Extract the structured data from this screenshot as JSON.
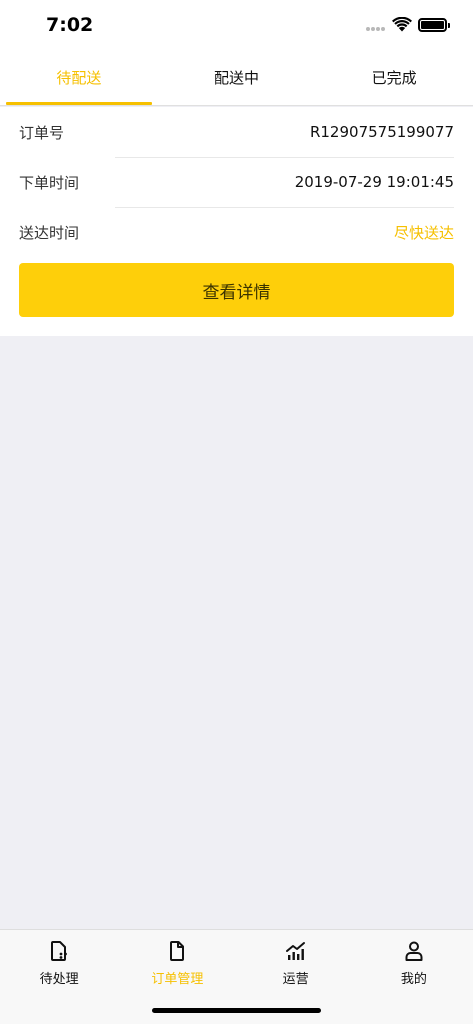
{
  "status_bar": {
    "time": "7:02"
  },
  "tabs": [
    {
      "label": "待配送",
      "active": true
    },
    {
      "label": "配送中",
      "active": false
    },
    {
      "label": "已完成",
      "active": false
    }
  ],
  "order": {
    "order_no_label": "订单号",
    "order_no_value": "R12907575199077",
    "order_time_label": "下单时间",
    "order_time_value": "2019-07-29 19:01:45",
    "delivery_time_label": "送达时间",
    "delivery_time_value": "尽快送达",
    "detail_button_label": "查看详情"
  },
  "tabbar": [
    {
      "label": "待处理",
      "icon": "pending-doc-icon",
      "active": false
    },
    {
      "label": "订单管理",
      "icon": "document-icon",
      "active": true
    },
    {
      "label": "运营",
      "icon": "chart-icon",
      "active": false
    },
    {
      "label": "我的",
      "icon": "person-icon",
      "active": false
    }
  ],
  "colors": {
    "accent": "#f6c000",
    "button": "#fecf0a",
    "background": "#efeff4"
  }
}
